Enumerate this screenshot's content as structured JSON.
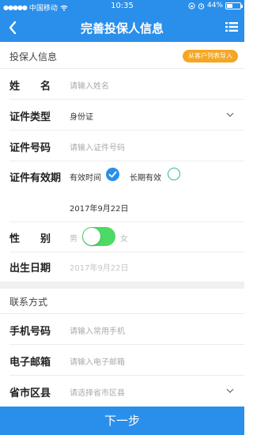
{
  "status_bar": {
    "carrier": "中国移动",
    "time": "10:35",
    "battery": "44%",
    "battery_level": 0.44
  },
  "nav": {
    "title": "完善投保人信息",
    "back_icon": "chevron-left-icon",
    "menu_icon": "list-icon"
  },
  "policyholder": {
    "section_title": "投保人信息",
    "import_button": "从客户列表导入",
    "name_label": "姓　　名",
    "name_placeholder": "请输入姓名",
    "id_type_label": "证件类型",
    "id_type_value": "身份证",
    "id_number_label": "证件号码",
    "id_number_placeholder": "请输入证件号码",
    "validity_label": "证件有效期",
    "validity_option_1": "有效时间",
    "validity_option_2": "长期有效",
    "validity_selected": "有效时间",
    "validity_date": "2017年9月22日",
    "gender_label": "性　　别",
    "gender_male": "男",
    "gender_female": "女",
    "birth_label": "出生日期",
    "birth_placeholder": "2017年9月22日"
  },
  "contact": {
    "section_title": "联系方式",
    "phone_label": "手机号码",
    "phone_placeholder": "请输入常用手机",
    "email_label": "电子邮箱",
    "email_placeholder": "请输入电子邮箱",
    "region_label": "省市区县",
    "region_placeholder": "请选择省市区县"
  },
  "next_button": "下一步",
  "colors": {
    "primary": "#2a8fea",
    "import": "#f5a623",
    "toggle_on": "#4cd964",
    "radio_off_border": "#2fb3a6"
  }
}
